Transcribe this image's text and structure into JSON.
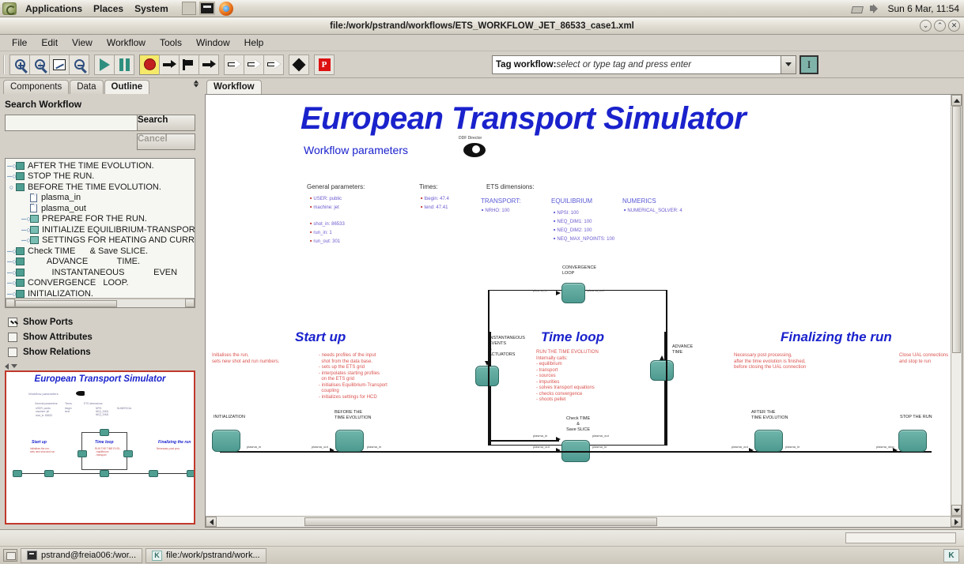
{
  "desktop": {
    "panel_menus": [
      "Applications",
      "Places",
      "System"
    ],
    "clock": "Sun  6 Mar, 11:54",
    "tray_icons": [
      "network-icon",
      "volume-icon"
    ],
    "launcher_icons": [
      "screenshot-icon",
      "terminal-icon",
      "firefox-icon"
    ]
  },
  "window": {
    "title": "file:/work/pstrand/workflows/ETS_WORKFLOW_JET_86533_case1.xml",
    "buttons": [
      "minimize",
      "maximize",
      "close"
    ],
    "button_glyphs": [
      "⌄",
      "⌃",
      "✕"
    ]
  },
  "menubar": {
    "items": [
      "File",
      "Edit",
      "View",
      "Workflow",
      "Tools",
      "Window",
      "Help"
    ]
  },
  "toolbar": {
    "buttons": [
      {
        "name": "zoom-in-icon"
      },
      {
        "name": "zoom-reset-icon"
      },
      {
        "name": "zoom-fit-icon"
      },
      {
        "name": "zoom-out-icon"
      },
      {
        "name": "run-icon"
      },
      {
        "name": "pause-icon"
      },
      {
        "name": "stop-icon"
      },
      {
        "name": "step-icon"
      },
      {
        "name": "flag-icon"
      },
      {
        "name": "step-into-icon"
      },
      {
        "name": "step-over-outline-icon"
      },
      {
        "name": "step-out-outline-icon"
      },
      {
        "name": "step-forward-outline-icon"
      },
      {
        "name": "diamond-icon"
      },
      {
        "name": "prediction-icon"
      }
    ],
    "prediction_letter": "P"
  },
  "tag": {
    "label": "Tag workflow:",
    "placeholder": "select or type tag and press enter",
    "dropdown_icon": "chevron-down-icon",
    "text_tool_glyph": "I"
  },
  "left_panel": {
    "tabs": [
      {
        "label": "Components",
        "active": false
      },
      {
        "label": "Data",
        "active": false
      },
      {
        "label": "Outline",
        "active": true
      }
    ],
    "search": {
      "title": "Search Workflow",
      "value": "",
      "placeholder": "",
      "search_button": "Search",
      "cancel_button": "Cancel"
    },
    "tree": [
      {
        "label": "AFTER THE TIME EVOLUTION.",
        "indent": 0,
        "handle": "─○",
        "icon": "composite-node"
      },
      {
        "label": "STOP THE RUN.",
        "indent": 0,
        "handle": "─○",
        "icon": "composite-node"
      },
      {
        "label": "BEFORE THE TIME EVOLUTION.",
        "indent": 0,
        "handle": "○",
        "icon": "composite-node"
      },
      {
        "label": "plasma_in",
        "indent": 1,
        "handle": "",
        "icon": "document-node"
      },
      {
        "label": "plasma_out",
        "indent": 1,
        "handle": "",
        "icon": "document-node"
      },
      {
        "label": "PREPARE FOR THE RUN.",
        "indent": 1,
        "handle": "─○",
        "icon": "composite-node"
      },
      {
        "label": "INITIALIZE EQUILIBRIUM-TRANSPOR",
        "indent": 1,
        "handle": "─○",
        "icon": "composite-node"
      },
      {
        "label": "SETTINGS FOR HEATING AND CURR",
        "indent": 1,
        "handle": "─○",
        "icon": "composite-node"
      },
      {
        "label": "Check TIME      & Save SLICE.",
        "indent": 0,
        "handle": "─○",
        "icon": "composite-node"
      },
      {
        "label": "        ADVANCE            TIME.",
        "indent": 0,
        "handle": "─○",
        "icon": "composite-node"
      },
      {
        "label": "          INSTANTANEOUS            EVEN",
        "indent": 0,
        "handle": "─○",
        "icon": "composite-node"
      },
      {
        "label": "CONVERGENCE   LOOP.",
        "indent": 0,
        "handle": "─○",
        "icon": "composite-node"
      },
      {
        "label": "INITIALIZATION.",
        "indent": 0,
        "handle": "─○",
        "icon": "composite-node"
      }
    ],
    "checkboxes": [
      {
        "label": "Show Ports",
        "checked": true
      },
      {
        "label": "Show Attributes",
        "checked": false
      },
      {
        "label": "Show Relations",
        "checked": false
      }
    ],
    "thumbnail_title": "European Transport Simulator"
  },
  "canvas": {
    "tab_label": "Workflow",
    "title": "European Transport Simulator",
    "params_label": "Workflow parameters",
    "director_label": "DDF Director",
    "director_icon": "director-icon",
    "sections": [
      {
        "header": "General parameters:",
        "items": [
          "USER: public",
          "machine: jet",
          "shot_in: 86533",
          "run_in: 1",
          "run_out: 301"
        ]
      },
      {
        "header": "Times:",
        "items": [
          "tbegin: 47.4",
          "tend: 47.41"
        ]
      }
    ],
    "ets_dimensions": {
      "header": "ETS dimensions:",
      "groups": [
        {
          "name": "TRANSPORT:",
          "items": [
            "NRHO: 100"
          ]
        },
        {
          "name": "EQUILIBRIUM",
          "items": [
            "NPSI: 100",
            "NEQ_DIM1: 100",
            "NEQ_DIM2: 100",
            "NEQ_MAX_NPOINTS: 100"
          ]
        },
        {
          "name": "NUMERICS",
          "items": [
            "NUMERICAL_SOLVER: 4"
          ]
        }
      ]
    },
    "phases": [
      {
        "name": "Start up"
      },
      {
        "name": "Time loop"
      },
      {
        "name": "Finalizing the run"
      }
    ],
    "annotations": {
      "startup_left": "Initialises the run,\nsets new shot and run numbers.",
      "startup_right": "- needs profiles of the input\n  shot from the data base.\n- sets up the ETS grid\n- interpolates starting profiles\n  on the ETS grid\n- initialises Equilibrium-Transport\n  coupling\n- initializes settings for HCD",
      "timeloop": "RUN THE TIME EVOLUTION\nInternally calls:\n- equilibrium\n- transport\n- sources\n- impurities\n- solves transport equations\n- checks convergence\n- shoots pellet",
      "final_left": "Necessary post processing,\nafter the time evolution is finished,\nbefore closing the UAL connection",
      "final_right": "Close UAL connections\nand stop te run"
    },
    "node_labels": {
      "convergence_loop": "CONVERGENCE\nLOOP",
      "instantaneous": "INSTANTANEOUS\nEVENTS\n&\nACTUATORS",
      "advance_time": "ADVANCE\nTIME",
      "check_time": "Check TIME\n&\nSave SLICE",
      "initialization": "INITIALIZATION",
      "before_evolution": "BEFORE THE\nTIME EVOLUTION",
      "after_evolution": "AFTER THE\nTIME EVOLUTION",
      "stop_run": "STOP THE RUN"
    },
    "port_labels": [
      "plasma_in",
      "plasma_out",
      "plasma_in",
      "plasma_out",
      "plasma_in",
      "plasma_out",
      "plasma_in",
      "plasma_out",
      "plasma_in",
      "plasma_out",
      "plasma_in",
      "plasma_stop",
      "plasma_in"
    ]
  },
  "taskbar": {
    "show_desktop": "show-desktop-icon",
    "items": [
      {
        "label": "pstrand@freia006:/wor...",
        "icon": "terminal-icon"
      },
      {
        "label": "file:/work/pstrand/work...",
        "icon": "kepler-icon"
      }
    ],
    "kepler_glyph": "K"
  },
  "colors": {
    "title_blue": "#1a22cc",
    "annotation_red": "#d9534f",
    "node_teal": "#4e9a90",
    "panel_bg": "#d4d0c8"
  }
}
